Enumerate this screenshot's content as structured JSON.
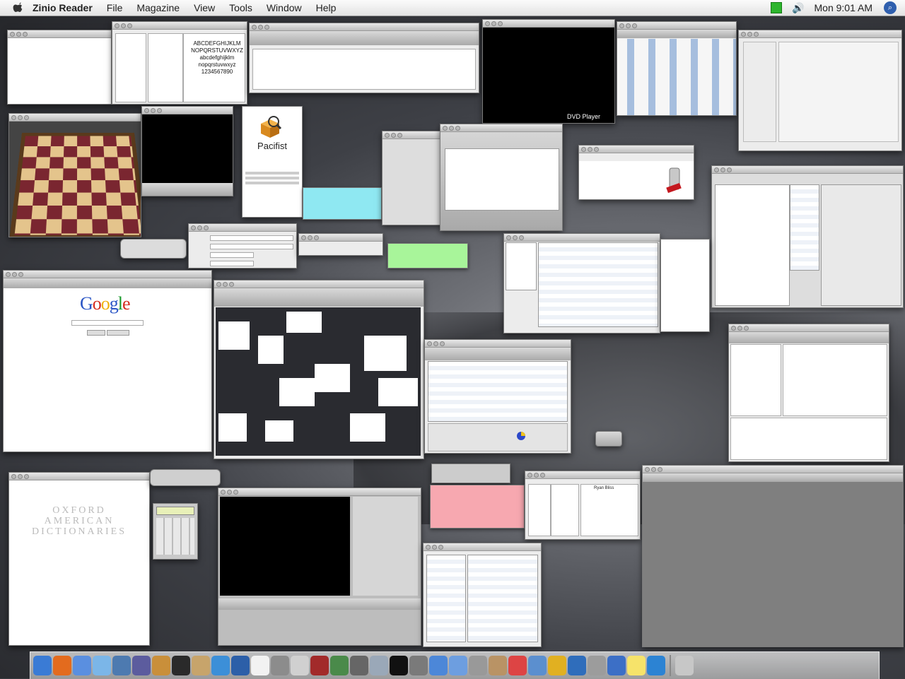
{
  "menubar": {
    "app_name": "Zinio Reader",
    "menus": [
      "File",
      "Magazine",
      "View",
      "Tools",
      "Window",
      "Help"
    ],
    "clock": "Mon 9:01 AM",
    "status_color": "#2db52d"
  },
  "font_book": {
    "sample_lines": [
      "ABCDEFGHIJKLM",
      "NOPQRSTUVWXYZ",
      "abcdefghijklm",
      "nopqrstuvwxyz",
      "1234567890"
    ]
  },
  "dvd_player": {
    "label": "DVD Player"
  },
  "pacifist": {
    "title": "Pacifist"
  },
  "google": {
    "letters": [
      "G",
      "o",
      "o",
      "g",
      "l",
      "e"
    ]
  },
  "dictionary": {
    "lines": [
      "OXFORD",
      "AMERICAN",
      "DICTIONARIES"
    ]
  },
  "address_book": {
    "name": "Ryan Bliss"
  },
  "sticky_notes": [
    {
      "color": "#8fe8f2"
    },
    {
      "color": "#a8f59a"
    },
    {
      "color": "#f7a8b0"
    }
  ],
  "dock": {
    "icons": [
      "finder-icon",
      "firefox-icon",
      "ichat-icon",
      "itunes-icon",
      "preview-icon",
      "imovie-icon",
      "garageband-icon",
      "idvd-icon",
      "addressbook-icon",
      "safari-icon",
      "xcode-icon",
      "textedit-icon",
      "photo-icon",
      "ipod-icon",
      "dictionary-icon",
      "globe-icon",
      "tools-icon",
      "system-icon",
      "terminal-icon",
      "camera-icon",
      "mail-icon",
      "folder-icon",
      "calculator-icon",
      "chess-icon",
      "ical-icon",
      "iphoto-icon",
      "sherlock-icon",
      "network-icon",
      "disk-icon",
      "quicktime-icon",
      "notes-icon",
      "quicktime2-icon",
      "trash-icon"
    ],
    "colors": [
      "#3a7bd5",
      "#e36b1e",
      "#5a8fe0",
      "#7bb6e8",
      "#4d7ab0",
      "#5c5c9e",
      "#c98f3a",
      "#2a2a2a",
      "#c7a46b",
      "#3c8fd8",
      "#2c5fa8",
      "#f2f2f2",
      "#8c8c8c",
      "#d0d0d0",
      "#a22a2a",
      "#4a8a4a",
      "#666",
      "#9aa8b8",
      "#111",
      "#7a7a7a",
      "#4c87d8",
      "#6d9ee0",
      "#999",
      "#b99365",
      "#d44",
      "#5b8fcf",
      "#e1b021",
      "#2f6dbb",
      "#9c9c9c",
      "#3c6fc6",
      "#f6e36a",
      "#2c83d3",
      "#c7c7c7"
    ]
  }
}
